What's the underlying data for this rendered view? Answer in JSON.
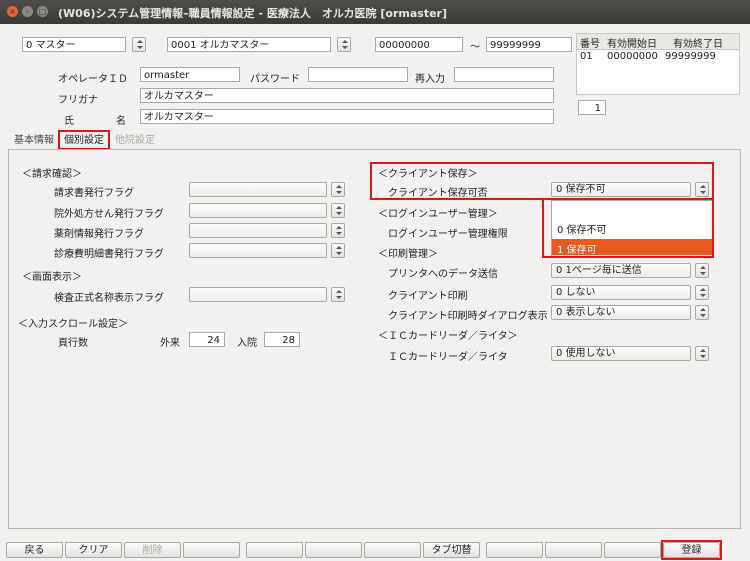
{
  "window": {
    "title": "(W06)システム管理情報–職員情報設定 - 医療法人　オルカ医院 [ormaster]",
    "close_glyph": "×",
    "min_glyph": "–",
    "max_glyph": "□"
  },
  "top": {
    "master_combo": "0 マスター",
    "user_combo": "0001 オルカマスター",
    "range_from": "00000000",
    "range_sep": "～",
    "range_to": "99999999",
    "grid_headers": [
      "番号",
      "有効開始日",
      "有効終了日"
    ],
    "grid_row": [
      "01",
      "00000000",
      "99999999"
    ],
    "page_number": "1"
  },
  "form": {
    "operator_id_label": "オペレータＩＤ",
    "operator_id_value": "ormaster",
    "password_label": "パスワード",
    "password_value": "",
    "reenter_label": "再入力",
    "reenter_value": "",
    "furigana_label": "フリガナ",
    "furigana_value": "オルカマスター",
    "name_label1": "氏",
    "name_label2": "名",
    "name_value": "オルカマスター"
  },
  "tabs": [
    "基本情報",
    "個別設定",
    "他院設定"
  ],
  "left": {
    "billing_header": "＜請求確認＞",
    "billing_items": [
      "請求書発行フラグ",
      "院外処方せん発行フラグ",
      "薬剤情報発行フラグ",
      "診療費明細書発行フラグ"
    ],
    "display_header": "＜画面表示＞",
    "display_items": [
      "検査正式名称表示フラグ"
    ],
    "scroll_header": "＜入力スクロール設定＞",
    "rows_label": "頁行数",
    "outpatient_label": "外来",
    "outpatient_value": "24",
    "inpatient_label": "入院",
    "inpatient_value": "28"
  },
  "right": {
    "client_save_header": "＜クライアント保存＞",
    "client_save_label": "クライアント保存可否",
    "client_save_value": "0 保存不可",
    "login_header": "＜ログインユーザー管理＞",
    "login_label": "ログインユーザー管理権限",
    "print_header": "＜印刷管理＞",
    "print_items": [
      {
        "label": "プリンタへのデータ送信",
        "value": "0 1ページ毎に送信"
      },
      {
        "label": "クライアント印刷",
        "value": "0 しない"
      },
      {
        "label": "クライアント印刷時ダイアログ表示",
        "value": "0 表示しない"
      }
    ],
    "ic_header": "＜ＩＣカードリーダ／ライタ＞",
    "ic_label": "ＩＣカードリーダ／ライタ",
    "ic_value": "0 使用しない"
  },
  "dropdown": {
    "options": [
      "0 保存不可",
      "1 保存可"
    ],
    "selected_index": 1
  },
  "footer": [
    "戻る",
    "クリア",
    "削除",
    "",
    "",
    "",
    "",
    "タブ切替",
    "",
    "",
    "",
    "登録"
  ],
  "colors": {
    "highlight": "#e85a20",
    "annotation": "#e41414",
    "titlebar": "#3f3e3a"
  }
}
